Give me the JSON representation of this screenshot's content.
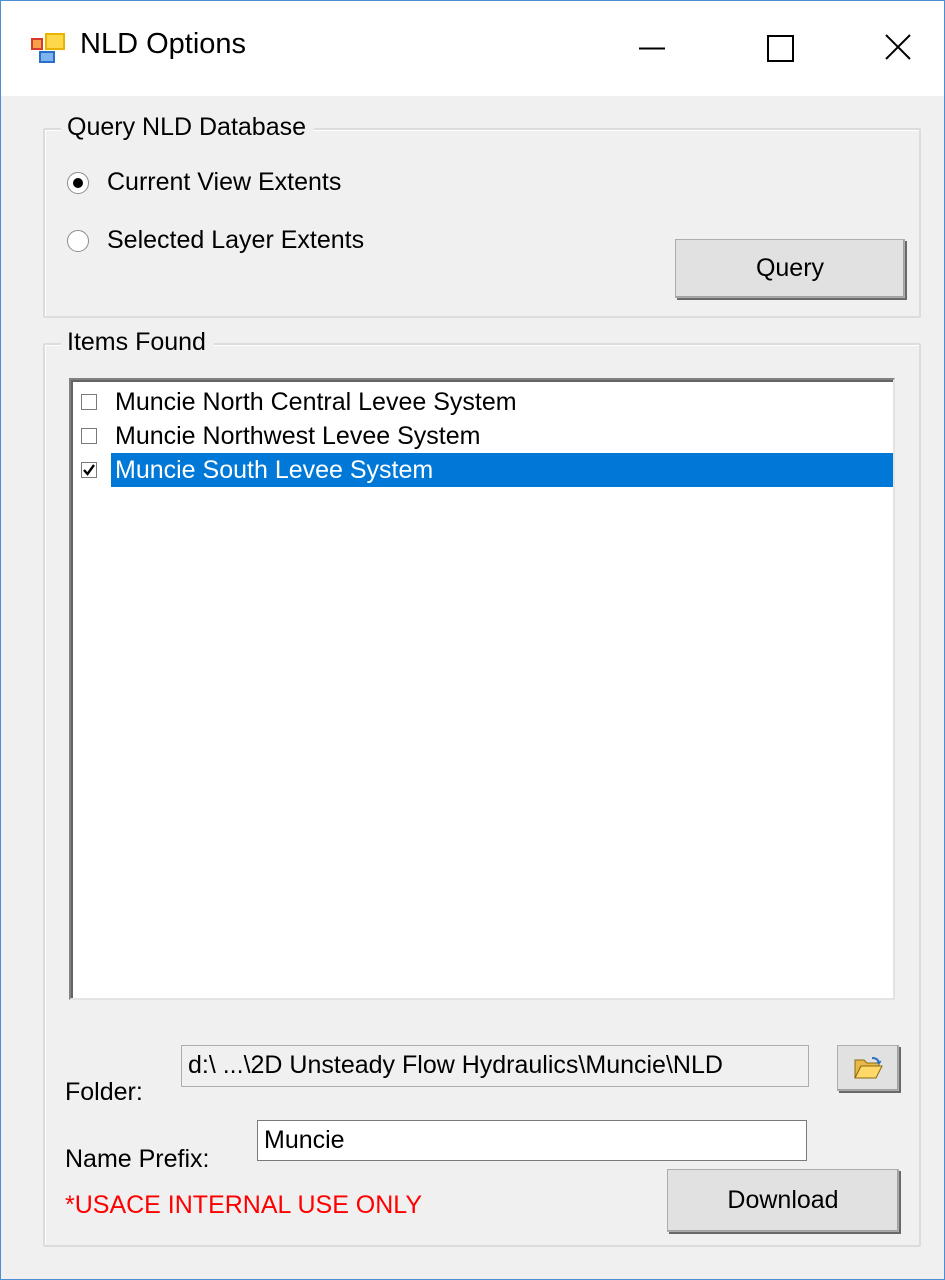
{
  "window": {
    "title": "NLD Options"
  },
  "titlebar": {
    "minimize_icon": "minimize-icon",
    "maximize_icon": "maximize-icon",
    "close_icon": "close-icon"
  },
  "query_group": {
    "legend": "Query NLD Database",
    "options": [
      {
        "label": "Current View Extents",
        "selected": true
      },
      {
        "label": "Selected Layer Extents",
        "selected": false
      }
    ],
    "query_button": "Query"
  },
  "items_group": {
    "legend": "Items Found",
    "items": [
      {
        "label": "Muncie North Central Levee System",
        "checked": false,
        "selected": false
      },
      {
        "label": "Muncie Northwest Levee System",
        "checked": false,
        "selected": false
      },
      {
        "label": "Muncie South Levee System",
        "checked": true,
        "selected": true
      }
    ]
  },
  "folder": {
    "label": "Folder:",
    "value": "d:\\ ...\\2D Unsteady Flow Hydraulics\\Muncie\\NLD",
    "browse_icon": "folder-open-icon"
  },
  "name_prefix": {
    "label": "Name Prefix:",
    "value": "Muncie"
  },
  "notice": {
    "text": "*USACE INTERNAL USE ONLY",
    "color": "#ff0000"
  },
  "download_button": "Download",
  "colors": {
    "selection": "#0078d7",
    "window_border": "#4a8fd6"
  }
}
